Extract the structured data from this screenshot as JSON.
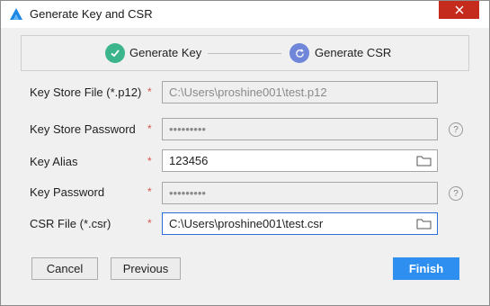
{
  "window": {
    "title": "Generate Key and CSR"
  },
  "steps": [
    {
      "label": "Generate Key",
      "state": "done",
      "color": "#3cb48c"
    },
    {
      "label": "Generate CSR",
      "state": "current",
      "color": "#6f86d9"
    }
  ],
  "form": {
    "key_store_file": {
      "label": "Key Store File (*.p12)",
      "required": "*",
      "value": "C:\\Users\\proshine001\\test.p12"
    },
    "key_store_password": {
      "label": "Key Store Password",
      "required": "*",
      "value": "•••••••••"
    },
    "key_alias": {
      "label": "Key Alias",
      "required": "*",
      "value": "123456"
    },
    "key_password": {
      "label": "Key Password",
      "required": "*",
      "value": "•••••••••"
    },
    "csr_file": {
      "label": "CSR File (*.csr)",
      "required": "*",
      "value": "C:\\Users\\proshine001\\test.csr"
    }
  },
  "help_glyph": "?",
  "buttons": {
    "cancel": "Cancel",
    "previous": "Previous",
    "finish": "Finish"
  },
  "colors": {
    "accent": "#2f8ff0",
    "close": "#c42b1c",
    "required": "#d9534f"
  },
  "icons": [
    "app-logo-icon",
    "close-icon",
    "check-icon",
    "refresh-icon",
    "folder-icon",
    "help-icon"
  ]
}
